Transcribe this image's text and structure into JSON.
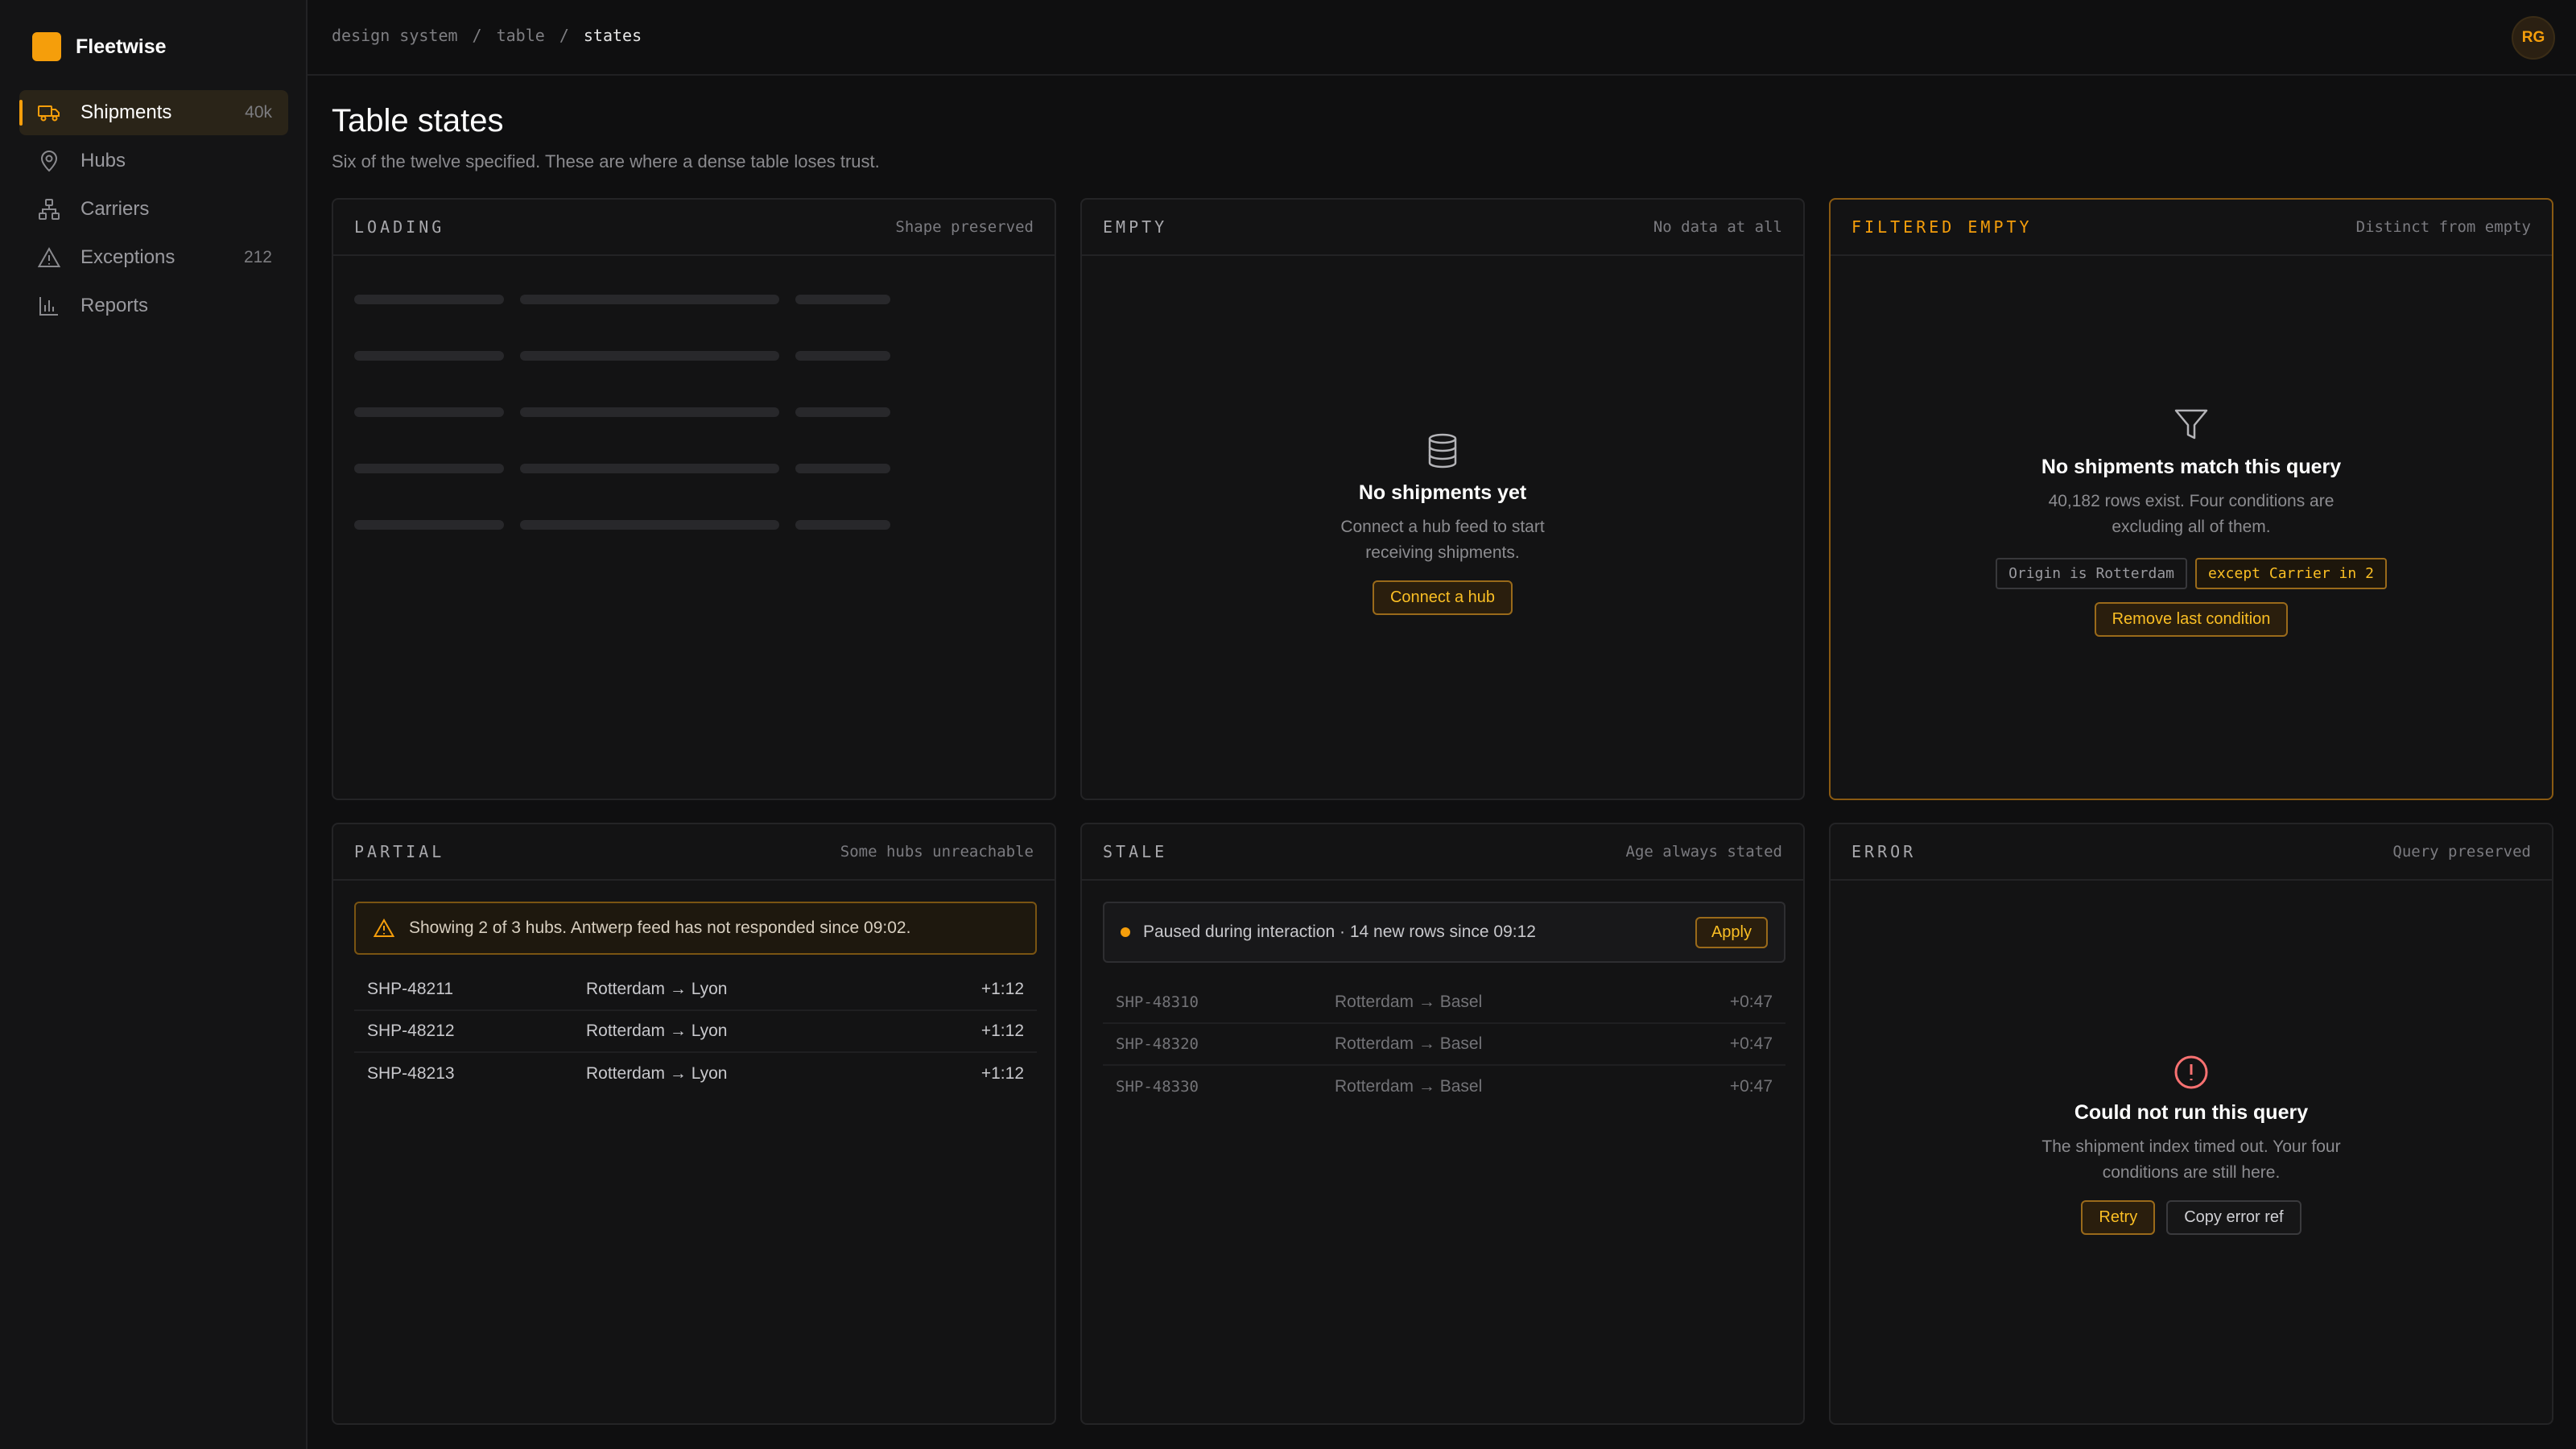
{
  "app": {
    "name": "Fleetwise"
  },
  "sidebar": {
    "items": [
      {
        "label": "Shipments",
        "count": "40k",
        "icon": "truck-icon",
        "active": true
      },
      {
        "label": "Hubs",
        "count": "",
        "icon": "map-pin-icon"
      },
      {
        "label": "Carriers",
        "count": "",
        "icon": "network-icon"
      },
      {
        "label": "Exceptions",
        "count": "212",
        "icon": "warning-icon"
      },
      {
        "label": "Reports",
        "count": "",
        "icon": "bar-chart-icon"
      }
    ]
  },
  "breadcrumb": [
    "design system",
    "/",
    "table",
    "/",
    "states"
  ],
  "user": {
    "initials": "RG"
  },
  "page": {
    "title": "Table states",
    "subtitle": "Six of the twelve specified. These are where a dense table loses trust."
  },
  "panels": {
    "loading": {
      "title": "LOADING",
      "note": "Shape preserved"
    },
    "empty": {
      "title": "EMPTY",
      "note": "No data at all",
      "heading": "No shipments yet",
      "desc_line1": "Connect a hub feed to start",
      "desc_line2": "receiving shipments.",
      "button": "Connect a hub"
    },
    "filtered": {
      "title": "FILTERED EMPTY",
      "note": "Distinct from empty",
      "heading": "No shipments match this query",
      "desc_line1": "40,182 rows exist. Four conditions are",
      "desc_line2": "excluding all of them.",
      "chip1": "Origin is Rotterdam",
      "chip2": "except Carrier in 2",
      "button": "Remove last condition"
    },
    "partial": {
      "title": "PARTIAL",
      "note": "Some hubs unreachable",
      "banner": "Showing 2 of 3 hubs. Antwerp feed has not responded since 09:02.",
      "rows": [
        {
          "id": "SHP-48211",
          "route": "Rotterdam → Lyon",
          "delta": "+1:12"
        },
        {
          "id": "SHP-48212",
          "route": "Rotterdam → Lyon",
          "delta": "+1:12"
        },
        {
          "id": "SHP-48213",
          "route": "Rotterdam → Lyon",
          "delta": "+1:12"
        }
      ]
    },
    "stale": {
      "title": "STALE",
      "note": "Age always stated",
      "banner": "Paused during interaction · 14 new rows since 09:12",
      "button": "Apply",
      "rows": [
        {
          "id": "SHP-48310",
          "route": "Rotterdam → Basel",
          "delta": "+0:47"
        },
        {
          "id": "SHP-48320",
          "route": "Rotterdam → Basel",
          "delta": "+0:47"
        },
        {
          "id": "SHP-48330",
          "route": "Rotterdam → Basel",
          "delta": "+0:47"
        }
      ]
    },
    "error": {
      "title": "ERROR",
      "note": "Query preserved",
      "heading": "Could not run this query",
      "desc_line1": "The shipment index timed out. Your four",
      "desc_line2": "conditions are still here.",
      "retry": "Retry",
      "copy": "Copy error ref"
    }
  },
  "colors": {
    "accent": "#f59e0b",
    "error": "#f87171",
    "background": "#0f0f10"
  }
}
